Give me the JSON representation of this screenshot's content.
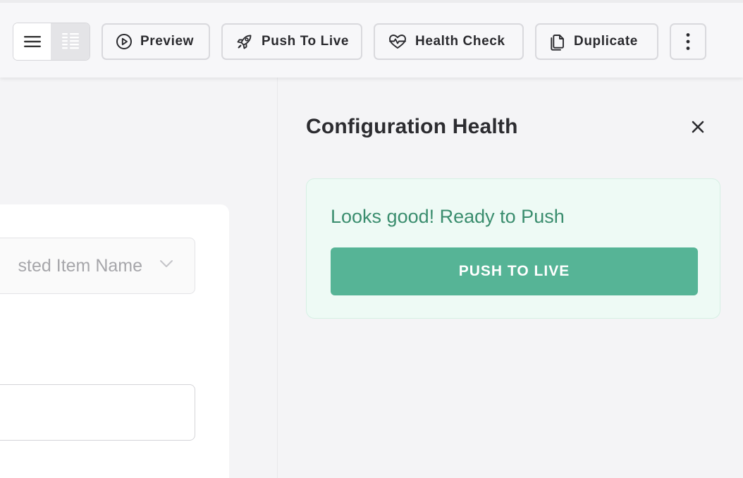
{
  "toolbar": {
    "view_toggle": {
      "options": [
        "list-view",
        "compact-view"
      ],
      "selected": "list-view"
    },
    "preview_label": "Preview",
    "push_label": "Push To Live",
    "health_label": "Health Check",
    "duplicate_label": "Duplicate"
  },
  "form": {
    "select_placeholder": "Suggested Item Name",
    "select_visible_text": "sted Item Name",
    "text_value": ""
  },
  "panel": {
    "title": "Configuration Health",
    "status_message": "Looks good! Ready to Push",
    "primary_action": "PUSH TO LIVE"
  },
  "colors": {
    "success_text": "#3a8d6e",
    "success_button": "#56b496",
    "success_bg": "#eefaf5"
  }
}
